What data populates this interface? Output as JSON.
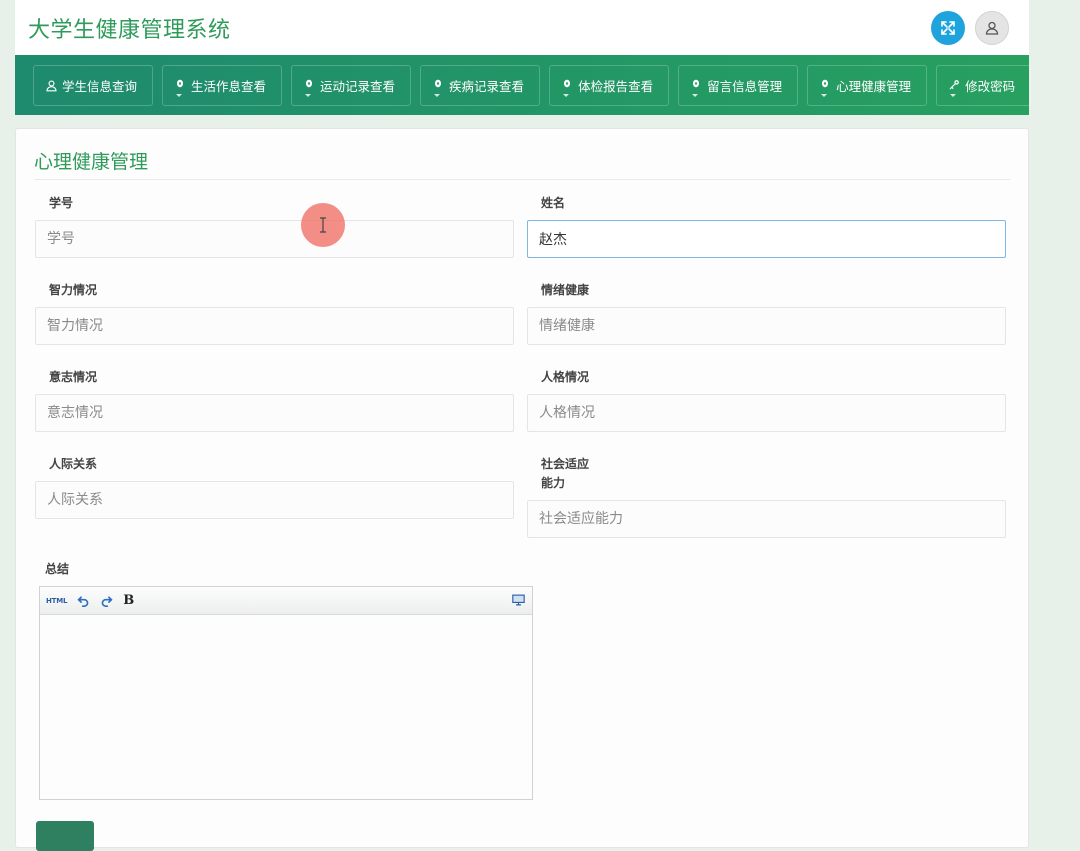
{
  "header": {
    "title": "大学生健康管理系统",
    "expand_icon": "expand-icon",
    "user_icon": "user-icon",
    "accent": "#1fa3dc"
  },
  "nav": {
    "items": [
      {
        "label": "学生信息查询",
        "icon": "user-icon"
      },
      {
        "label": "生活作息查看",
        "icon": "leaf-icon"
      },
      {
        "label": "运动记录查看",
        "icon": "leaf-icon"
      },
      {
        "label": "疾病记录查看",
        "icon": "leaf-icon"
      },
      {
        "label": "体检报告查看",
        "icon": "leaf-icon"
      },
      {
        "label": "留言信息管理",
        "icon": "leaf-icon"
      },
      {
        "label": "心理健康管理",
        "icon": "leaf-icon"
      },
      {
        "label": "修改密码",
        "icon": "key-icon"
      }
    ],
    "color": "#27a060"
  },
  "form": {
    "title": "心理健康管理",
    "fields": {
      "student_id": {
        "label": "学号",
        "placeholder": "学号",
        "value": ""
      },
      "name": {
        "label": "姓名",
        "placeholder": "姓名",
        "value": "赵杰"
      },
      "intelligence": {
        "label": "智力情况",
        "placeholder": "智力情况",
        "value": ""
      },
      "emotion": {
        "label": "情绪健康",
        "placeholder": "情绪健康",
        "value": ""
      },
      "will": {
        "label": "意志情况",
        "placeholder": "意志情况",
        "value": ""
      },
      "personality": {
        "label": "人格情况",
        "placeholder": "人格情况",
        "value": ""
      },
      "relations": {
        "label": "人际关系",
        "placeholder": "人际关系",
        "value": ""
      },
      "social_line1": "社会适应",
      "social_line2": "能力",
      "social": {
        "placeholder": "社会适应能力",
        "value": ""
      },
      "summary": {
        "label": "总结"
      }
    },
    "editor_toolbar": {
      "html": "HTML",
      "bold": "B"
    }
  }
}
